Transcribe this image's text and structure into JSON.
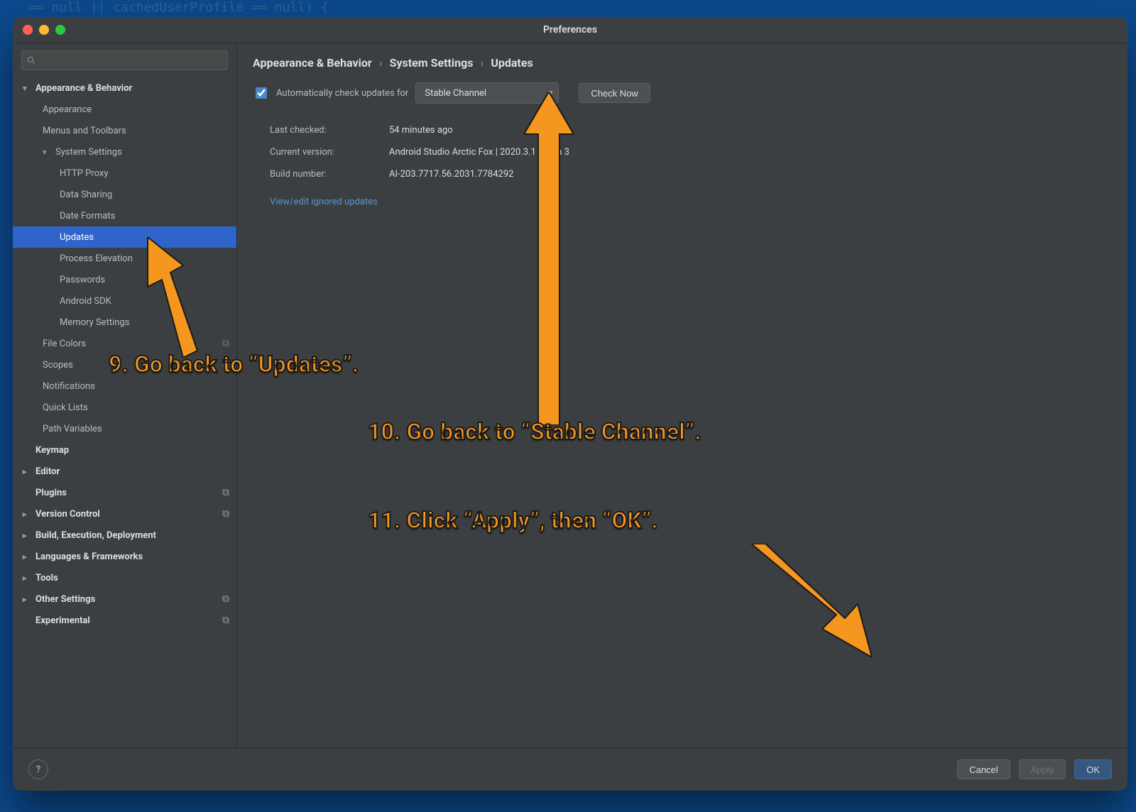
{
  "window": {
    "title": "Preferences"
  },
  "traffic": {
    "close": "#ff5f57",
    "min": "#febc2e",
    "max": "#28c840"
  },
  "search": {
    "placeholder": ""
  },
  "sidebar": {
    "items": [
      {
        "label": "Appearance & Behavior",
        "level": 0,
        "bold": true,
        "chev": "▾"
      },
      {
        "label": "Appearance",
        "level": 1
      },
      {
        "label": "Menus and Toolbars",
        "level": 1
      },
      {
        "label": "System Settings",
        "level": 1,
        "chev": "▾"
      },
      {
        "label": "HTTP Proxy",
        "level": 2
      },
      {
        "label": "Data Sharing",
        "level": 2
      },
      {
        "label": "Date Formats",
        "level": 2
      },
      {
        "label": "Updates",
        "level": 2,
        "selected": true
      },
      {
        "label": "Process Elevation",
        "level": 2
      },
      {
        "label": "Passwords",
        "level": 2
      },
      {
        "label": "Android SDK",
        "level": 2
      },
      {
        "label": "Memory Settings",
        "level": 2
      },
      {
        "label": "File Colors",
        "level": 1,
        "copy": true
      },
      {
        "label": "Scopes",
        "level": 1,
        "copy": true
      },
      {
        "label": "Notifications",
        "level": 1
      },
      {
        "label": "Quick Lists",
        "level": 1
      },
      {
        "label": "Path Variables",
        "level": 1
      },
      {
        "label": "Keymap",
        "level": 0,
        "bold": true
      },
      {
        "label": "Editor",
        "level": 0,
        "bold": true,
        "chev": "▸"
      },
      {
        "label": "Plugins",
        "level": 0,
        "bold": true,
        "copy": true
      },
      {
        "label": "Version Control",
        "level": 0,
        "bold": true,
        "chev": "▸",
        "copy": true
      },
      {
        "label": "Build, Execution, Deployment",
        "level": 0,
        "bold": true,
        "chev": "▸"
      },
      {
        "label": "Languages & Frameworks",
        "level": 0,
        "bold": true,
        "chev": "▸"
      },
      {
        "label": "Tools",
        "level": 0,
        "bold": true,
        "chev": "▸"
      },
      {
        "label": "Other Settings",
        "level": 0,
        "bold": true,
        "chev": "▸",
        "copy": true
      },
      {
        "label": "Experimental",
        "level": 0,
        "bold": true,
        "copy": true
      }
    ]
  },
  "breadcrumb": {
    "a": "Appearance & Behavior",
    "b": "System Settings",
    "c": "Updates"
  },
  "updates": {
    "checkbox_label": "Automatically check updates for",
    "channel": "Stable Channel",
    "check_now": "Check Now",
    "last_checked_label": "Last checked:",
    "last_checked_value": "54 minutes ago",
    "current_version_label": "Current version:",
    "current_version_value": "Android Studio Arctic Fox | 2020.3.1 Patch 3",
    "build_label": "Build number:",
    "build_value": "AI-203.7717.56.2031.7784292",
    "ignored_link": "View/edit ignored updates"
  },
  "footer": {
    "cancel": "Cancel",
    "apply": "Apply",
    "ok": "OK"
  },
  "annotations": {
    "a9": "9. Go back to “Updates”.",
    "a10": "10. Go back to “Stable Channel”.",
    "a11": "11. Click “Apply”, then “OK”."
  }
}
